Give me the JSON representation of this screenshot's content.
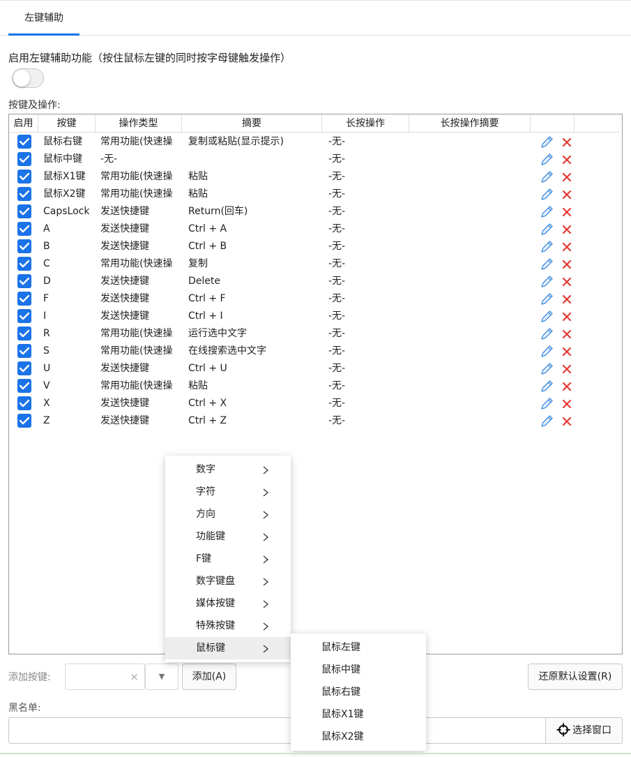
{
  "tabs": [
    {
      "label": "左键辅助"
    }
  ],
  "feature": {
    "label": "启用左键辅助功能（按住鼠标左键的同时按字母键触发操作）",
    "enabled": false
  },
  "table": {
    "section_label": "按键及操作:",
    "headers": [
      "启用",
      "按键",
      "操作类型",
      "摘要",
      "长按操作",
      "长按操作摘要"
    ],
    "rows": [
      {
        "enabled": true,
        "key": "鼠标右键",
        "type": "常用功能(快速操",
        "summary": "复制或粘贴(显示提示)",
        "long_press": "-无-",
        "long_summary": ""
      },
      {
        "enabled": true,
        "key": "鼠标中键",
        "type": "-无-",
        "summary": "",
        "long_press": "-无-",
        "long_summary": ""
      },
      {
        "enabled": true,
        "key": "鼠标X1键",
        "type": "常用功能(快速操",
        "summary": "粘贴",
        "long_press": "-无-",
        "long_summary": ""
      },
      {
        "enabled": true,
        "key": "鼠标X2键",
        "type": "常用功能(快速操",
        "summary": "粘贴",
        "long_press": "-无-",
        "long_summary": ""
      },
      {
        "enabled": true,
        "key": "CapsLock",
        "type": "发送快捷键",
        "summary": "Return(回车)",
        "long_press": "-无-",
        "long_summary": ""
      },
      {
        "enabled": true,
        "key": "A",
        "type": "发送快捷键",
        "summary": "Ctrl + A",
        "long_press": "-无-",
        "long_summary": ""
      },
      {
        "enabled": true,
        "key": "B",
        "type": "发送快捷键",
        "summary": "Ctrl + B",
        "long_press": "-无-",
        "long_summary": ""
      },
      {
        "enabled": true,
        "key": "C",
        "type": "常用功能(快速操",
        "summary": "复制",
        "long_press": "-无-",
        "long_summary": ""
      },
      {
        "enabled": true,
        "key": "D",
        "type": "发送快捷键",
        "summary": "Delete",
        "long_press": "-无-",
        "long_summary": ""
      },
      {
        "enabled": true,
        "key": "F",
        "type": "发送快捷键",
        "summary": "Ctrl + F",
        "long_press": "-无-",
        "long_summary": ""
      },
      {
        "enabled": true,
        "key": "I",
        "type": "发送快捷键",
        "summary": "Ctrl + I",
        "long_press": "-无-",
        "long_summary": ""
      },
      {
        "enabled": true,
        "key": "R",
        "type": "常用功能(快速操",
        "summary": "运行选中文字",
        "long_press": "-无-",
        "long_summary": ""
      },
      {
        "enabled": true,
        "key": "S",
        "type": "常用功能(快速操",
        "summary": "在线搜索选中文字",
        "long_press": "-无-",
        "long_summary": ""
      },
      {
        "enabled": true,
        "key": "U",
        "type": "发送快捷键",
        "summary": "Ctrl + U",
        "long_press": "-无-",
        "long_summary": ""
      },
      {
        "enabled": true,
        "key": "V",
        "type": "常用功能(快速操",
        "summary": "粘贴",
        "long_press": "-无-",
        "long_summary": ""
      },
      {
        "enabled": true,
        "key": "X",
        "type": "发送快捷键",
        "summary": "Ctrl + X",
        "long_press": "-无-",
        "long_summary": ""
      },
      {
        "enabled": true,
        "key": "Z",
        "type": "发送快捷键",
        "summary": "Ctrl + Z",
        "long_press": "-无-",
        "long_summary": ""
      }
    ]
  },
  "add": {
    "label": "添加按键:",
    "value": "",
    "clear_glyph": "×",
    "dropdown_glyph": "▼",
    "button": "添加(A)"
  },
  "reset_button": "还原默认设置(R)",
  "blacklist": {
    "label": "黑名单:",
    "value": "",
    "pick_button": "选择窗口"
  },
  "menu": {
    "items": [
      {
        "label": "数字"
      },
      {
        "label": "字符"
      },
      {
        "label": "方向"
      },
      {
        "label": "功能键"
      },
      {
        "label": "F键"
      },
      {
        "label": "数字键盘"
      },
      {
        "label": "媒体按键"
      },
      {
        "label": "特殊按键"
      },
      {
        "label": "鼠标键",
        "active": true
      }
    ],
    "submenu": [
      "鼠标左键",
      "鼠标中键",
      "鼠标右键",
      "鼠标X1键",
      "鼠标X2键"
    ]
  },
  "colors": {
    "accent": "#1a73e8",
    "delete": "#e53935",
    "edit": "#3d8de0"
  },
  "icons": {
    "edit": "pencil-icon",
    "delete": "close-icon",
    "chevron": "chevron-right-icon",
    "pick": "crosshair-icon"
  }
}
